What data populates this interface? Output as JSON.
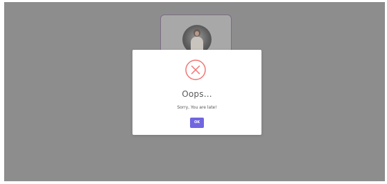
{
  "background_card": {
    "avatar_icon": "user-photo-avatar"
  },
  "alert": {
    "icon": "error-x-circle-icon",
    "icon_color": "#f27474",
    "title": "Oops...",
    "text": "Sorry, You are late!",
    "confirm_button_label": "OK",
    "confirm_button_color": "#7066e0"
  },
  "colors": {
    "overlay": "#8d8d8d",
    "modal_background": "#ffffff"
  }
}
